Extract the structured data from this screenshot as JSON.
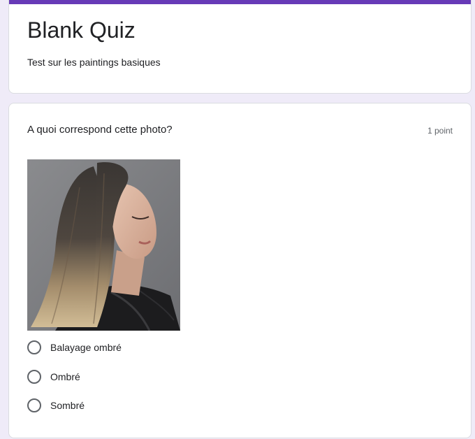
{
  "form": {
    "title": "Blank Quiz",
    "description": "Test sur les paintings basiques",
    "accent_color": "#673ab7"
  },
  "question": {
    "title": "A quoi correspond cette photo?",
    "points": "1 point",
    "image": "woman-ombre-hair-photo",
    "options": [
      {
        "label": "Balayage ombré",
        "selected": false
      },
      {
        "label": "Ombré",
        "selected": false
      },
      {
        "label": "Sombré",
        "selected": false
      }
    ]
  }
}
